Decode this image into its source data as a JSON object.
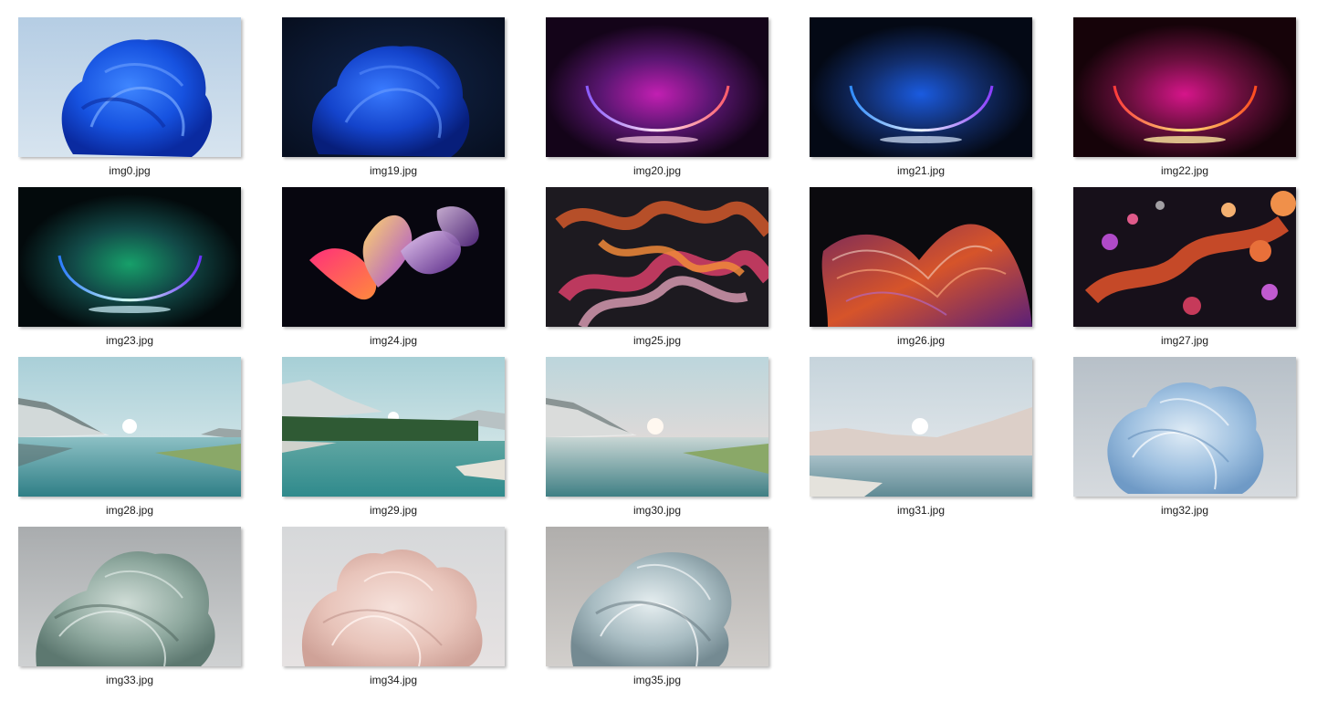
{
  "files": [
    {
      "name": "img0.jpg"
    },
    {
      "name": "img19.jpg"
    },
    {
      "name": "img20.jpg"
    },
    {
      "name": "img21.jpg"
    },
    {
      "name": "img22.jpg"
    },
    {
      "name": "img23.jpg"
    },
    {
      "name": "img24.jpg"
    },
    {
      "name": "img25.jpg"
    },
    {
      "name": "img26.jpg"
    },
    {
      "name": "img27.jpg"
    },
    {
      "name": "img28.jpg"
    },
    {
      "name": "img29.jpg"
    },
    {
      "name": "img30.jpg"
    },
    {
      "name": "img31.jpg"
    },
    {
      "name": "img32.jpg"
    },
    {
      "name": "img33.jpg"
    },
    {
      "name": "img34.jpg"
    },
    {
      "name": "img35.jpg"
    }
  ]
}
